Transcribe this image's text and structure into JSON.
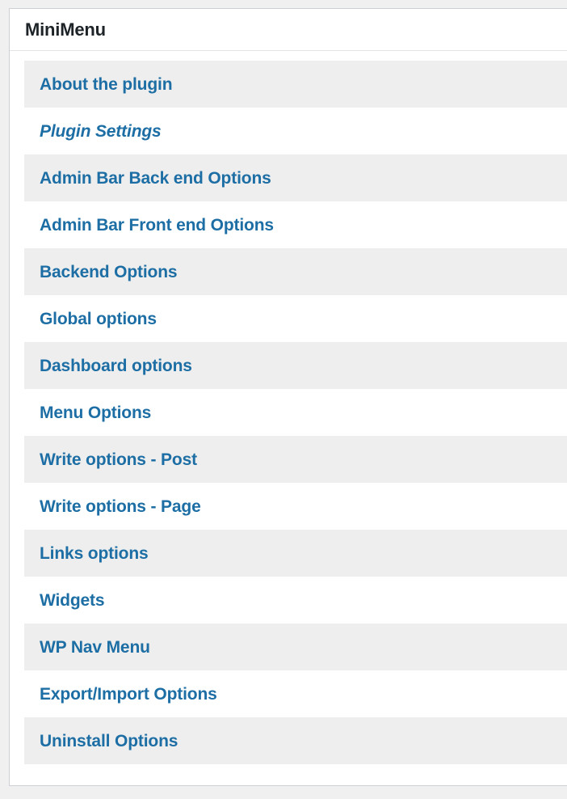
{
  "theme": {
    "page_background": "#f0f0f1",
    "card_background": "#ffffff",
    "card_border": "#ccd0d4",
    "header_rule": "#e5e5e5",
    "row_alt_background": "#eeeeee",
    "link_color": "#1c6ea4",
    "title_color": "#1d2327"
  },
  "panel": {
    "title": "MiniMenu"
  },
  "menu": {
    "items": [
      {
        "label": "About the plugin",
        "style": "normal",
        "shaded": true
      },
      {
        "label": "Plugin Settings",
        "style": "italic",
        "shaded": false
      },
      {
        "label": "Admin Bar Back end Options",
        "style": "normal",
        "shaded": true
      },
      {
        "label": "Admin Bar Front end Options",
        "style": "normal",
        "shaded": false
      },
      {
        "label": "Backend Options",
        "style": "normal",
        "shaded": true
      },
      {
        "label": "Global options",
        "style": "normal",
        "shaded": false
      },
      {
        "label": "Dashboard options",
        "style": "normal",
        "shaded": true
      },
      {
        "label": "Menu Options",
        "style": "normal",
        "shaded": false
      },
      {
        "label": "Write options - Post",
        "style": "normal",
        "shaded": true
      },
      {
        "label": "Write options - Page",
        "style": "normal",
        "shaded": false
      },
      {
        "label": "Links options",
        "style": "normal",
        "shaded": true
      },
      {
        "label": "Widgets",
        "style": "normal",
        "shaded": false
      },
      {
        "label": "WP Nav Menu",
        "style": "normal",
        "shaded": true
      },
      {
        "label": "Export/Import Options",
        "style": "normal",
        "shaded": false
      },
      {
        "label": "Uninstall Options",
        "style": "normal",
        "shaded": true
      }
    ]
  }
}
